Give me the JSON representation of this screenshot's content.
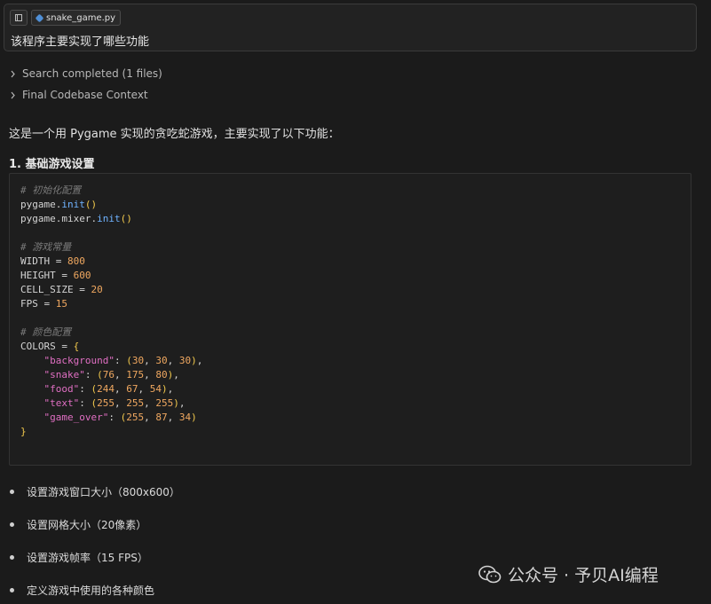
{
  "prompt": {
    "file_name": "snake_game.py",
    "question": "该程序主要实现了哪些功能"
  },
  "collapsibles": [
    {
      "label": "Search completed (1 files)"
    },
    {
      "label": "Final Codebase Context"
    }
  ],
  "answer": {
    "intro": "这是一个用 Pygame 实现的贪吃蛇游戏，主要实现了以下功能：",
    "section_title": "1. 基础游戏设置"
  },
  "code": {
    "comment_init": "# 初始化配置",
    "init_prefix": "pygame.",
    "init_call": "init",
    "mixer_prefix": "pygame.mixer.",
    "mixer_call": "init",
    "comment_const": "# 游戏常量",
    "width_name": "WIDTH = ",
    "width_val": "800",
    "height_name": "HEIGHT = ",
    "height_val": "600",
    "cell_name": "CELL_SIZE = ",
    "cell_val": "20",
    "fps_name": "FPS = ",
    "fps_val": "15",
    "comment_colors": "# 颜色配置",
    "colors_name": "COLORS = ",
    "colors": [
      {
        "key": "\"background\"",
        "r": "30",
        "g": "30",
        "b": "30"
      },
      {
        "key": "\"snake\"",
        "r": "76",
        "g": "175",
        "b": "80"
      },
      {
        "key": "\"food\"",
        "r": "244",
        "g": "67",
        "b": "54"
      },
      {
        "key": "\"text\"",
        "r": "255",
        "g": "255",
        "b": "255"
      },
      {
        "key": "\"game_over\"",
        "r": "255",
        "g": "87",
        "b": "34"
      }
    ]
  },
  "bullets": [
    "设置游戏窗口大小（800x600）",
    "设置网格大小（20像素）",
    "设置游戏帧率（15 FPS）",
    "定义游戏中使用的各种颜色"
  ],
  "watermark": "公众号 · 予贝AI编程"
}
